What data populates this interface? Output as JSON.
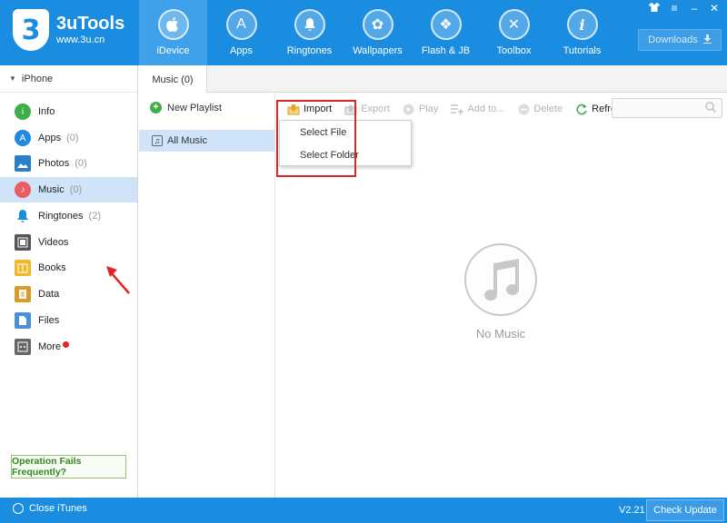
{
  "app": {
    "title": "3uTools",
    "url": "www.3u.cn",
    "logo_glyph": "3"
  },
  "nav": [
    {
      "label": "iDevice",
      "icon": "apple-icon",
      "glyph": "",
      "active": true
    },
    {
      "label": "Apps",
      "icon": "apps-icon",
      "glyph": "A"
    },
    {
      "label": "Ringtones",
      "icon": "bell-icon",
      "glyph": "♪"
    },
    {
      "label": "Wallpapers",
      "icon": "flower-icon",
      "glyph": "✿"
    },
    {
      "label": "Flash & JB",
      "icon": "box-icon",
      "glyph": "❖"
    },
    {
      "label": "Toolbox",
      "icon": "tools-icon",
      "glyph": "✕"
    },
    {
      "label": "Tutorials",
      "icon": "info-icon",
      "glyph": "i"
    }
  ],
  "downloads_label": "Downloads",
  "window_controls": {
    "shirt": "👕",
    "menu": "≡",
    "minimize": "–",
    "close": "✕"
  },
  "sidebar": {
    "device": "iPhone",
    "items": [
      {
        "label": "Info",
        "count": "",
        "color": "#3fae49",
        "glyph": "i"
      },
      {
        "label": "Apps",
        "count": "(0)",
        "color": "#1f8ae0",
        "glyph": "A"
      },
      {
        "label": "Photos",
        "count": "(0)",
        "color": "#2a7fc8",
        "glyph": "▣"
      },
      {
        "label": "Music",
        "count": "(0)",
        "color": "#e95d62",
        "glyph": "♪"
      },
      {
        "label": "Ringtones",
        "count": "(2)",
        "color": "#1a8de0",
        "glyph": "🔔"
      },
      {
        "label": "Videos",
        "count": "",
        "color": "#555555",
        "glyph": "▤"
      },
      {
        "label": "Books",
        "count": "",
        "color": "#f0b830",
        "glyph": "▥"
      },
      {
        "label": "Data",
        "count": "",
        "color": "#d99a2b",
        "glyph": "▦"
      },
      {
        "label": "Files",
        "count": "",
        "color": "#4a90d9",
        "glyph": "▧"
      },
      {
        "label": "More",
        "count": "",
        "color": "#666666",
        "glyph": "▨"
      }
    ],
    "op_fails": "Operation Fails Frequently?"
  },
  "tab": {
    "label": "Music (0)"
  },
  "playlist": {
    "new_label": "New Playlist",
    "all_music": "All Music"
  },
  "toolbar": {
    "import": "Import",
    "export": "Export",
    "play": "Play",
    "add_to": "Add to...",
    "delete": "Delete",
    "refresh": "Refresh"
  },
  "dropdown": {
    "select_file": "Select File",
    "select_folder": "Select Folder"
  },
  "empty": {
    "text": "No Music"
  },
  "footer": {
    "close_itunes": "Close iTunes",
    "version": "V2.21",
    "check_update": "Check Update"
  },
  "colors": {
    "brand": "#1a8de0",
    "highlight": "#d9262b",
    "selected": "#cfe4f8"
  }
}
